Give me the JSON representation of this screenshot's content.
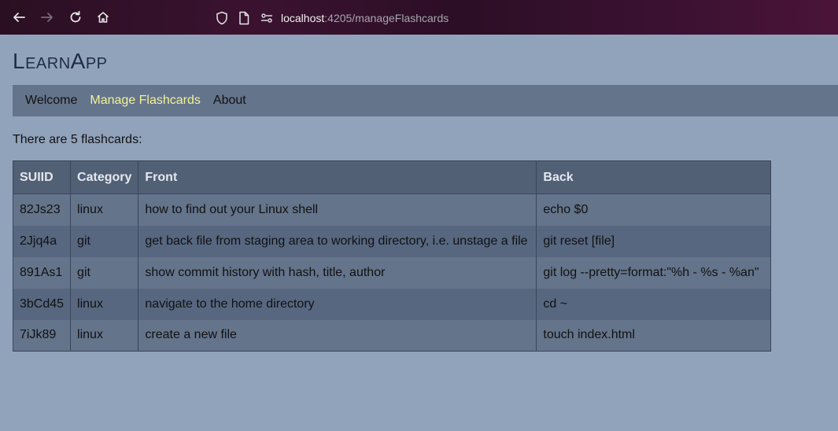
{
  "browser": {
    "url_host": "localhost",
    "url_path": ":4205/manageFlashcards"
  },
  "app": {
    "title": "LearnApp"
  },
  "nav": {
    "items": [
      {
        "label": "Welcome",
        "active": false
      },
      {
        "label": "Manage Flashcards",
        "active": true
      },
      {
        "label": "About",
        "active": false
      }
    ]
  },
  "content": {
    "count_text": "There are 5 flashcards:"
  },
  "table": {
    "headers": [
      "SUIID",
      "Category",
      "Front",
      "Back"
    ],
    "rows": [
      [
        "82Js23",
        "linux",
        "how to find out your Linux shell",
        "echo $0"
      ],
      [
        "2Jjq4a",
        "git",
        "get back file from staging area to working directory, i.e. unstage a file",
        "git reset [file]"
      ],
      [
        "891As1",
        "git",
        "show commit history with hash, title, author",
        "git log --pretty=format:\"%h - %s - %an\""
      ],
      [
        "3bCd45",
        "linux",
        "navigate to the home directory",
        "cd ~"
      ],
      [
        "7iJk89",
        "linux",
        "create a new file",
        "touch index.html"
      ]
    ]
  },
  "colors": {
    "page_bg": "#91a3bb",
    "nav_bg": "#64748b",
    "nav_active": "#f2f29a",
    "table_header_bg": "#526076"
  }
}
